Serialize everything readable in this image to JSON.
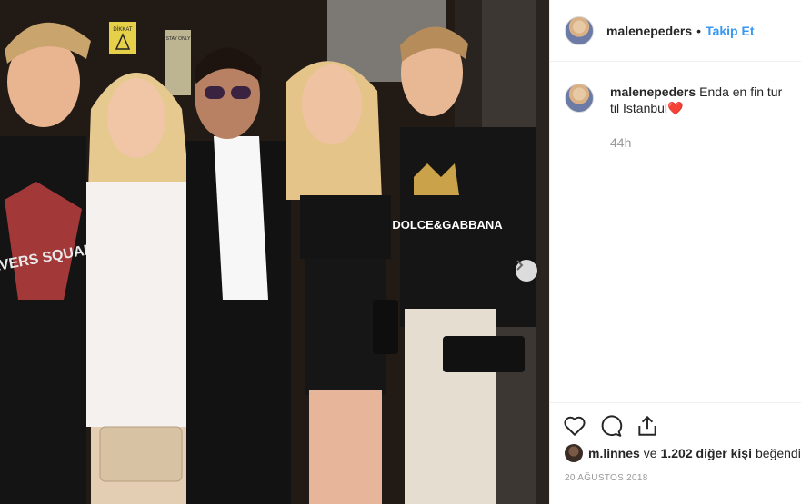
{
  "header": {
    "username": "malenepeders",
    "separator": "•",
    "follow_label": "Takip Et"
  },
  "caption": {
    "username": "malenepeders",
    "text": "Enda en fin tur til Istanbul",
    "emoji": "❤️",
    "time": "44h"
  },
  "likes": {
    "first_user": "m.linnes",
    "connector": "ve",
    "others": "1.202 diğer kişi",
    "suffix": "beğendi"
  },
  "date": "20 AĞUSTOS 2018",
  "photo": {
    "sign_top": "DİKKAT",
    "sign_panel": "STAY ONLY",
    "shirt_text": "DOLCE&GABBANA",
    "shirt_band": "SAVERS SQUAD"
  },
  "icons": {
    "like": "heart-icon",
    "comment": "comment-icon",
    "share": "share-icon",
    "next": "chevron-right-icon"
  },
  "colors": {
    "accent": "#3897f0",
    "heart": "#ed4956"
  }
}
